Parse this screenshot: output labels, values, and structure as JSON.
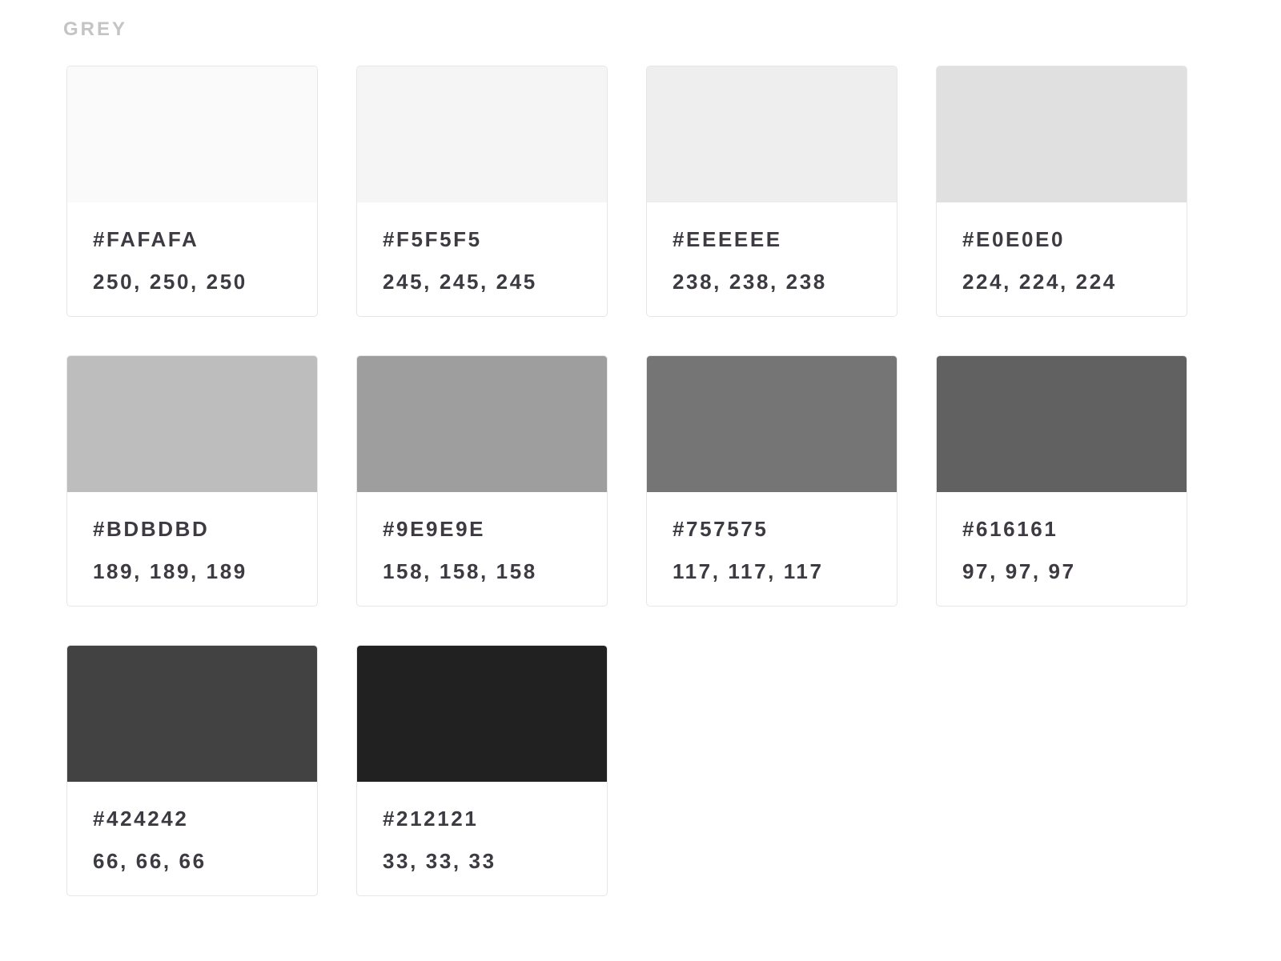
{
  "section": {
    "title": "GREY"
  },
  "swatches": [
    {
      "hex": "#FAFAFA",
      "rgb": "250, 250, 250",
      "color": "#FAFAFA"
    },
    {
      "hex": "#F5F5F5",
      "rgb": "245, 245, 245",
      "color": "#F5F5F5"
    },
    {
      "hex": "#EEEEEE",
      "rgb": "238, 238, 238",
      "color": "#EEEEEE"
    },
    {
      "hex": "#E0E0E0",
      "rgb": "224, 224, 224",
      "color": "#E0E0E0"
    },
    {
      "hex": "#BDBDBD",
      "rgb": "189, 189, 189",
      "color": "#BDBDBD"
    },
    {
      "hex": "#9E9E9E",
      "rgb": "158, 158, 158",
      "color": "#9E9E9E"
    },
    {
      "hex": "#757575",
      "rgb": "117, 117, 117",
      "color": "#757575"
    },
    {
      "hex": "#616161",
      "rgb": "97, 97, 97",
      "color": "#616161"
    },
    {
      "hex": "#424242",
      "rgb": "66, 66, 66",
      "color": "#424242"
    },
    {
      "hex": "#212121",
      "rgb": "33, 33, 33",
      "color": "#212121"
    }
  ],
  "colors": {
    "title_text": "#C4C4C4",
    "label_text": "#3D3A42",
    "card_border": "#E6E6E9",
    "page_background": "#FFFFFF"
  }
}
